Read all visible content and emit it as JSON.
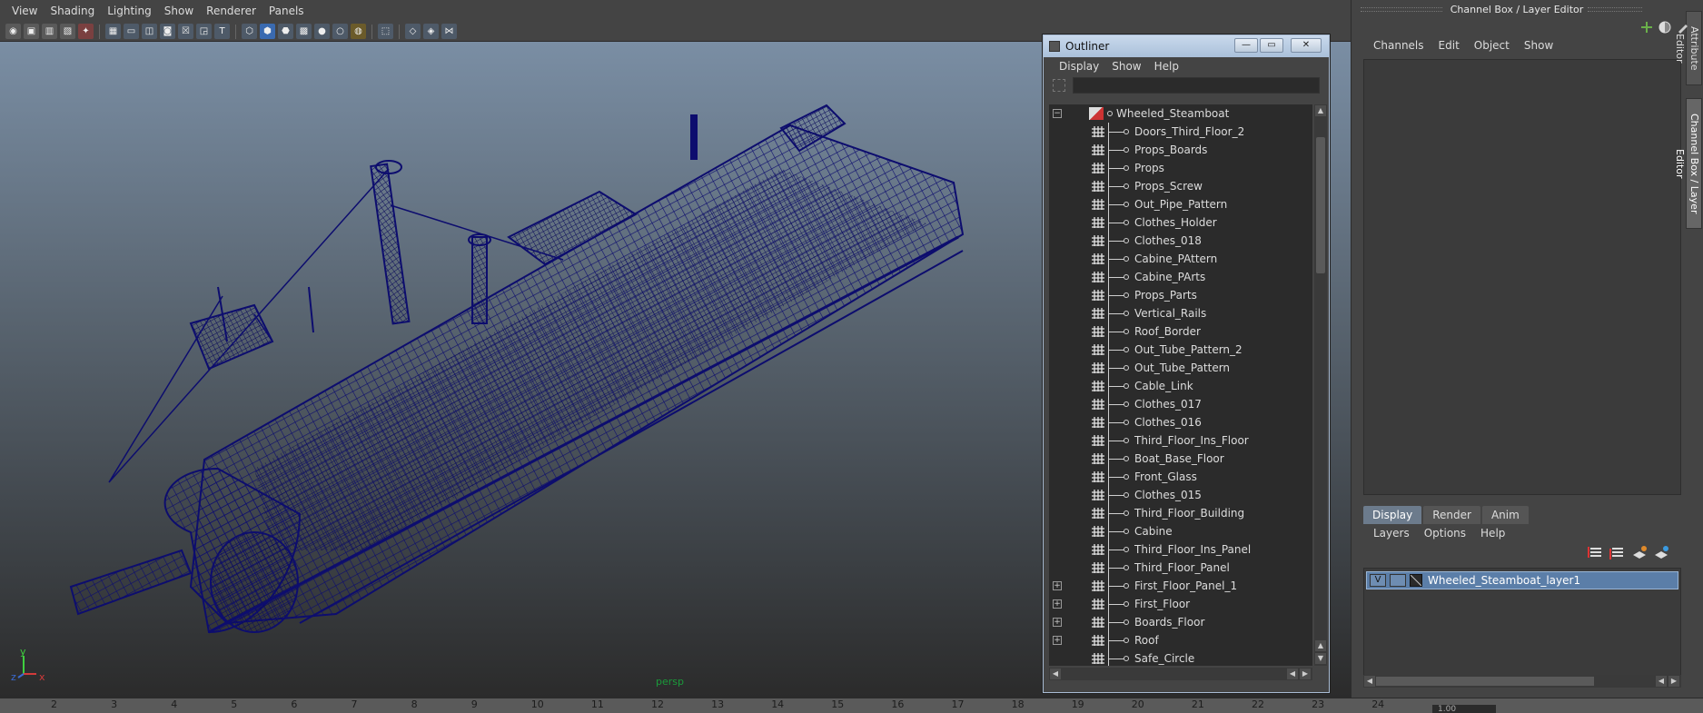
{
  "viewport": {
    "menus": [
      "View",
      "Shading",
      "Lighting",
      "Show",
      "Renderer",
      "Panels"
    ],
    "camera_label": "persp",
    "axis": {
      "y": "y",
      "x": "x",
      "z": "z"
    }
  },
  "outliner": {
    "title": "Outliner",
    "menus": [
      "Display",
      "Show",
      "Help"
    ],
    "search_value": "",
    "root": "Wheeled_Steamboat",
    "items": [
      {
        "name": "Doors_Third_Floor_2",
        "expandable": false
      },
      {
        "name": "Props_Boards",
        "expandable": false
      },
      {
        "name": "Props",
        "expandable": false
      },
      {
        "name": "Props_Screw",
        "expandable": false
      },
      {
        "name": "Out_Pipe_Pattern",
        "expandable": false
      },
      {
        "name": "Clothes_Holder",
        "expandable": false
      },
      {
        "name": "Clothes_018",
        "expandable": false
      },
      {
        "name": "Cabine_PAttern",
        "expandable": false
      },
      {
        "name": "Cabine_PArts",
        "expandable": false
      },
      {
        "name": "Props_Parts",
        "expandable": false
      },
      {
        "name": "Vertical_Rails",
        "expandable": false
      },
      {
        "name": "Roof_Border",
        "expandable": false
      },
      {
        "name": "Out_Tube_Pattern_2",
        "expandable": false
      },
      {
        "name": "Out_Tube_Pattern",
        "expandable": false
      },
      {
        "name": "Cable_Link",
        "expandable": false
      },
      {
        "name": "Clothes_017",
        "expandable": false
      },
      {
        "name": "Clothes_016",
        "expandable": false
      },
      {
        "name": "Third_Floor_Ins_Floor",
        "expandable": false
      },
      {
        "name": "Boat_Base_Floor",
        "expandable": false
      },
      {
        "name": "Front_Glass",
        "expandable": false
      },
      {
        "name": "Clothes_015",
        "expandable": false
      },
      {
        "name": "Third_Floor_Building",
        "expandable": false
      },
      {
        "name": "Cabine",
        "expandable": false
      },
      {
        "name": "Third_Floor_Ins_Panel",
        "expandable": false
      },
      {
        "name": "Third_Floor_Panel",
        "expandable": false
      },
      {
        "name": "First_Floor_Panel_1",
        "expandable": true
      },
      {
        "name": "First_Floor",
        "expandable": true
      },
      {
        "name": "Boards_Floor",
        "expandable": true
      },
      {
        "name": "Roof",
        "expandable": true
      },
      {
        "name": "Safe_Circle",
        "expandable": false
      }
    ]
  },
  "channel_box": {
    "title": "Channel Box / Layer Editor",
    "menus": [
      "Channels",
      "Edit",
      "Object",
      "Show"
    ],
    "layer_tabs": [
      "Display",
      "Render",
      "Anim"
    ],
    "active_layer_tab": "Display",
    "layer_menus": [
      "Layers",
      "Options",
      "Help"
    ],
    "layers": [
      {
        "visible": "V",
        "name": "Wheeled_Steamboat_layer1"
      }
    ],
    "side_tabs": [
      "Attribute Editor",
      "Channel Box / Layer Editor"
    ],
    "timeline_field": "1.00"
  },
  "timeline": {
    "ticks": [
      "2",
      "3",
      "4",
      "5",
      "6",
      "7",
      "8",
      "9",
      "10",
      "11",
      "12",
      "13",
      "14",
      "15",
      "16",
      "17",
      "18",
      "19",
      "20",
      "21",
      "22",
      "23",
      "24"
    ]
  },
  "colors": {
    "wireframe": "#0d0d6e",
    "selection_accent": "#5b7ea8",
    "camera_label": "#1a9a3a"
  }
}
